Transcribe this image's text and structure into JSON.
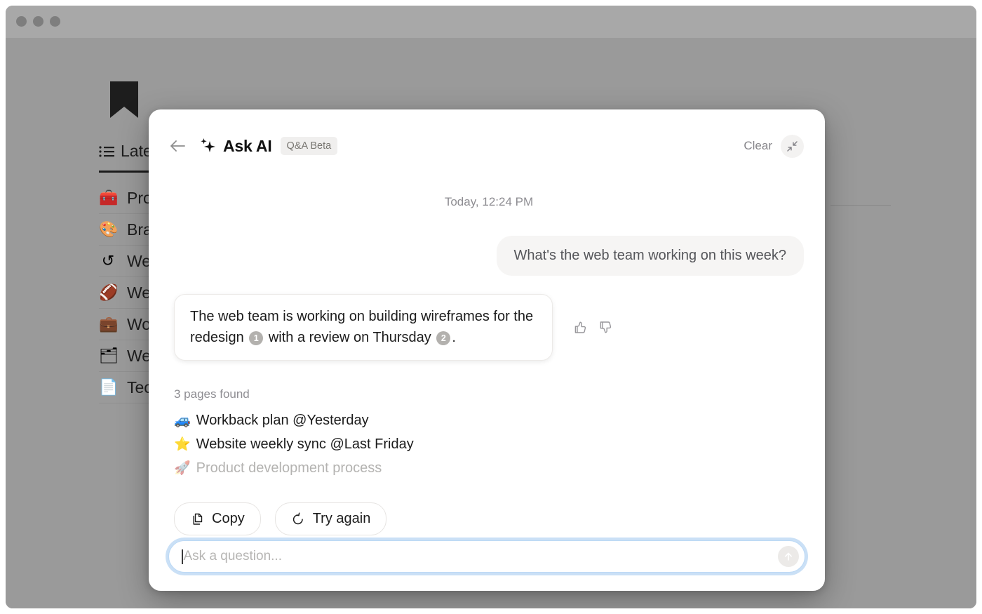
{
  "window": {
    "traffic_lights": [
      "close",
      "minimize",
      "maximize"
    ]
  },
  "background_app": {
    "logo_icon": "bookmark-icon",
    "tab": {
      "icon": "list-icon",
      "label": "Latest"
    },
    "list_items": [
      {
        "emoji": "🧰",
        "label": "Product roadmap"
      },
      {
        "emoji": "🎨",
        "label": "Brand guidelines"
      },
      {
        "emoji": "↺",
        "label": "Website redesign"
      },
      {
        "emoji": "🏈",
        "label": "Weekly standup"
      },
      {
        "emoji": "💼",
        "label": "Work tracker"
      },
      {
        "emoji": "🗂",
        "label": "Web projects"
      },
      {
        "emoji": "📄",
        "label": "Tech specs"
      }
    ]
  },
  "modal": {
    "header": {
      "back_icon": "arrow-left-icon",
      "sparkle_icon": "sparkles-icon",
      "title": "Ask AI",
      "badge": "Q&A Beta",
      "clear_label": "Clear",
      "collapse_icon": "collapse-icon"
    },
    "conversation": {
      "timestamp": "Today, 12:24 PM",
      "user_message": "What's the web team working on this week?",
      "assistant_message": {
        "part1": "The web team is working on building wireframes for the redesign",
        "citation1": "1",
        "part2": "with a review on Thursday",
        "citation2": "2",
        "part3": "."
      },
      "feedback": {
        "thumbs_up_icon": "thumbs-up-icon",
        "thumbs_down_icon": "thumbs-down-icon"
      }
    },
    "sources": {
      "heading": "3 pages found",
      "items": [
        {
          "emoji": "🚙",
          "label": "Workback plan @Yesterday",
          "dimmed": false
        },
        {
          "emoji": "⭐",
          "label": "Website weekly sync @Last Friday",
          "dimmed": false
        },
        {
          "emoji": "🚀",
          "label": "Product development process",
          "dimmed": true
        }
      ]
    },
    "actions": [
      {
        "icon": "copy-icon",
        "label": "Copy"
      },
      {
        "icon": "refresh-icon",
        "label": "Try again"
      }
    ],
    "composer": {
      "placeholder": "Ask a question...",
      "value": "",
      "send_icon": "arrow-up-icon"
    }
  },
  "colors": {
    "backdrop": "#9a9a9a",
    "modal_bg": "#ffffff",
    "focus_ring": "#8abaeb",
    "citation_badge": "#b3b1ae",
    "muted_text": "#8e8d92"
  }
}
